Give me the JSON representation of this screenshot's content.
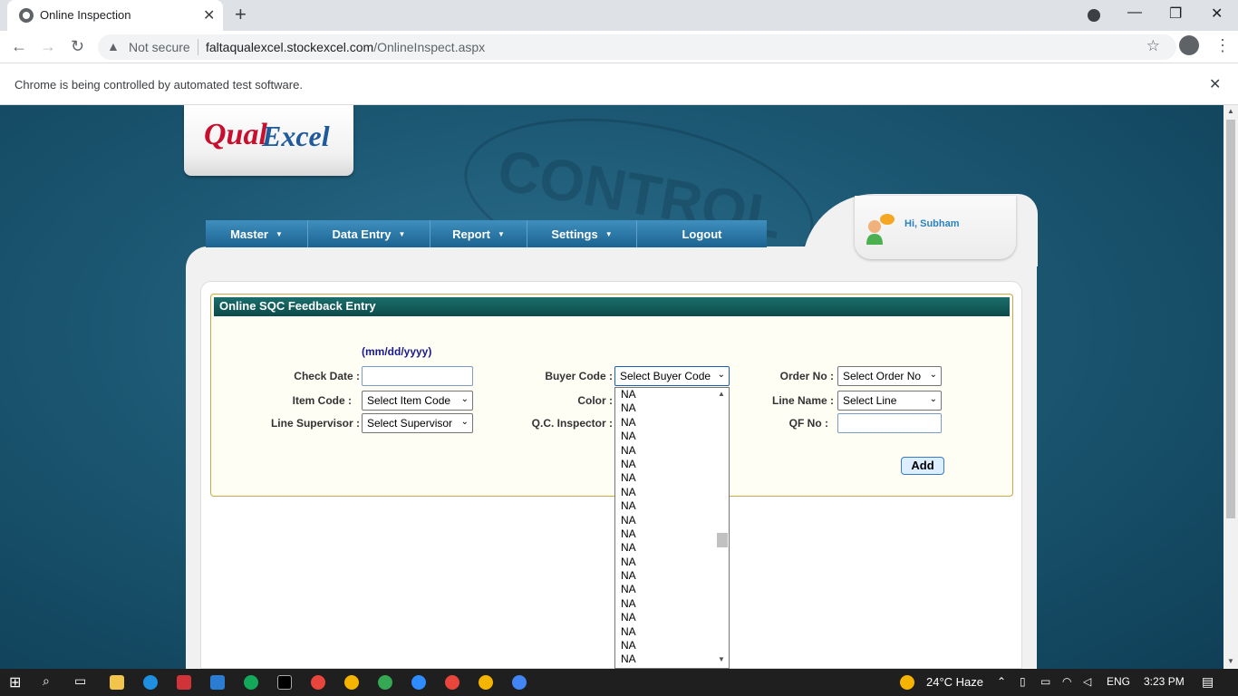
{
  "browser": {
    "tab_title": "Online Inspection",
    "url_security": "Not secure",
    "url_host": "faltaqualexcel.stockexcel.com",
    "url_path": "/OnlineInspect.aspx",
    "infobar": "Chrome is being controlled by automated test software."
  },
  "logo": {
    "part1": "Qual",
    "part2": "Excel"
  },
  "watermark": "CONTROL",
  "user": {
    "greeting": "Hi, Subham"
  },
  "menu": [
    {
      "label": "Master",
      "dropdown": true
    },
    {
      "label": "Data Entry",
      "dropdown": true
    },
    {
      "label": "Report",
      "dropdown": true
    },
    {
      "label": "Settings",
      "dropdown": true
    },
    {
      "label": "Logout",
      "dropdown": false
    }
  ],
  "form": {
    "title": "Online SQC Feedback Entry",
    "date_hint": "(mm/dd/yyyy)",
    "check_date_label": "Check Date :",
    "check_date_value": "",
    "item_code_label": "Item Code :",
    "item_code_value": "Select Item Code",
    "line_supervisor_label": "Line Supervisor :",
    "line_supervisor_value": "Select Supervisor",
    "buyer_code_label": "Buyer Code :",
    "buyer_code_value": "Select Buyer Code",
    "color_label": "Color :",
    "qc_inspector_label": "Q.C. Inspector :",
    "order_no_label": "Order No :",
    "order_no_value": "Select Order No",
    "line_name_label": "Line Name :",
    "line_name_value": "Select Line",
    "qf_no_label": "QF No :",
    "qf_no_value": "",
    "add_label": "Add"
  },
  "buyer_dropdown": {
    "options": [
      "NA",
      "NA",
      "NA",
      "NA",
      "NA",
      "NA",
      "NA",
      "NA",
      "NA",
      "NA",
      "NA",
      "NA",
      "NA",
      "NA",
      "NA",
      "NA",
      "NA",
      "NA",
      "NA",
      "NA"
    ]
  },
  "taskbar": {
    "weather": "24°C  Haze",
    "lang": "ENG",
    "time": "3:23 PM"
  },
  "colors": {
    "page_bg": "#1c5873",
    "menu_bar": "#1b6391",
    "form_header": "#0c4b4a",
    "logo_red": "#c8102e",
    "logo_blue": "#1f5a9b"
  }
}
